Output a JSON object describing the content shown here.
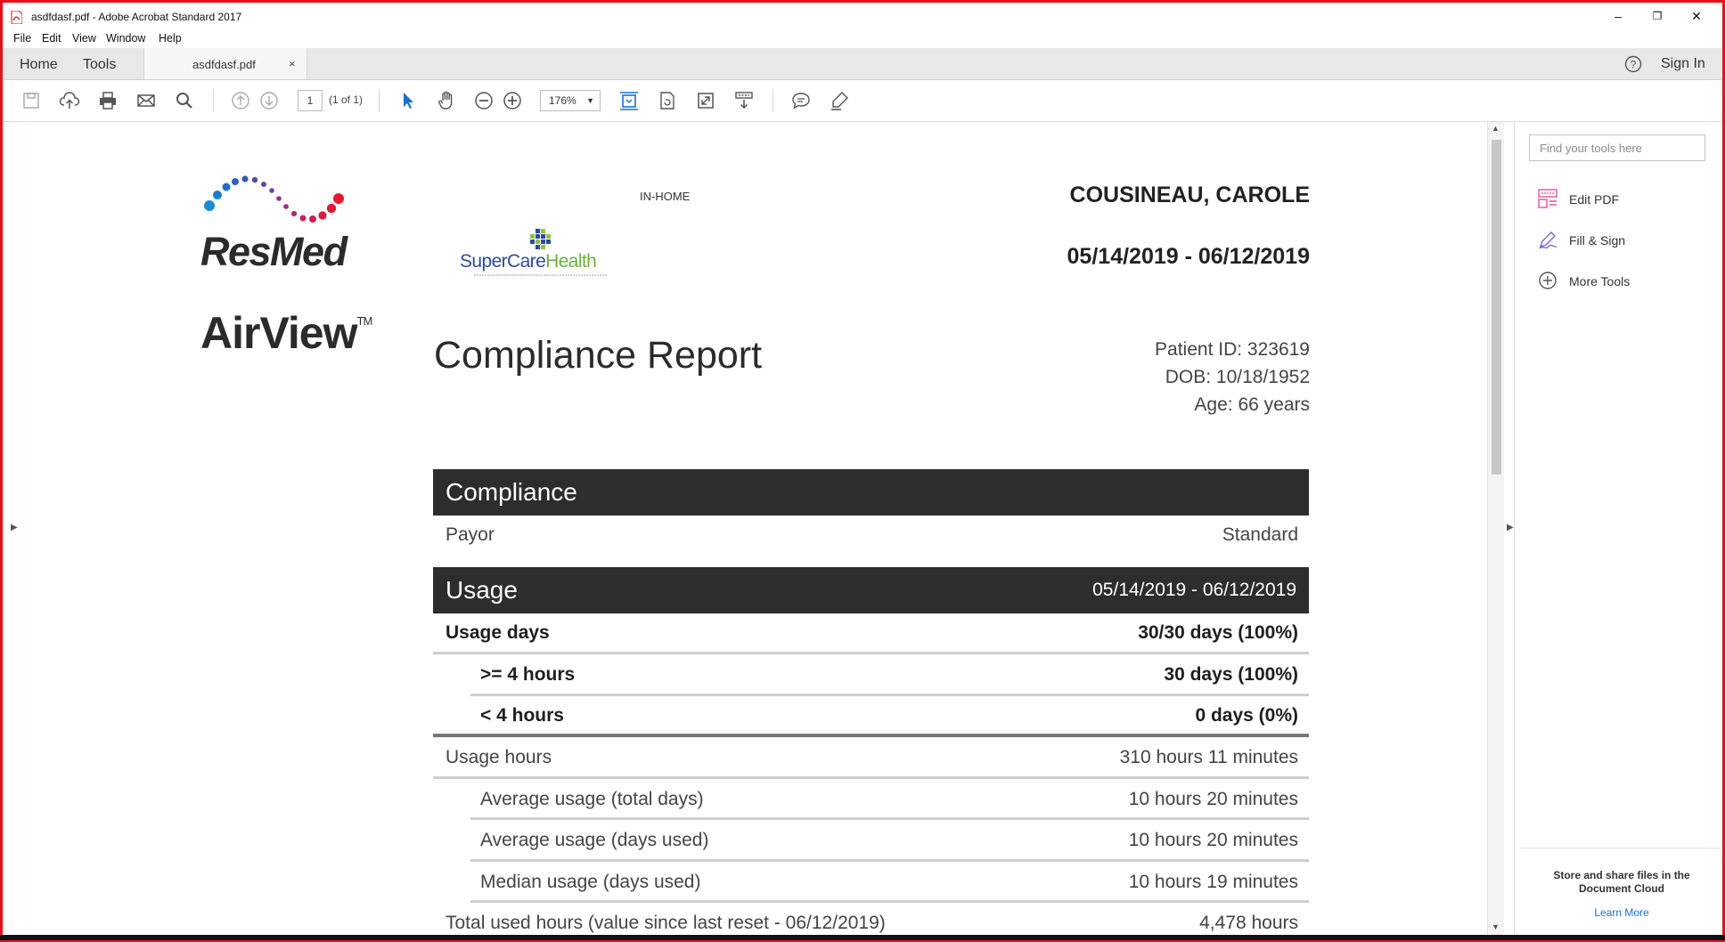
{
  "window": {
    "title": "asdfdasf.pdf - Adobe Acrobat Standard 2017",
    "minimize": "–",
    "restore": "❐",
    "close": "✕"
  },
  "menu": [
    "File",
    "Edit",
    "View",
    "Window",
    "Help"
  ],
  "tabs": {
    "home": "Home",
    "tools": "Tools",
    "document": "asdfdasf.pdf",
    "close": "×",
    "sign_in": "Sign In"
  },
  "toolbar": {
    "page_number": "1",
    "page_of": "(1 of 1)",
    "zoom": "176%",
    "icons": [
      "save-icon",
      "upload-icon",
      "print-icon",
      "email-icon",
      "search-icon",
      "prev-page-icon",
      "next-page-icon",
      "select-pointer-icon",
      "hand-icon",
      "zoom-out-icon",
      "zoom-in-icon",
      "fit-page-icon",
      "rotate-icon",
      "full-screen-icon",
      "scroll-mode-icon",
      "comment-icon",
      "highlight-icon"
    ]
  },
  "right_panel": {
    "search_placeholder": "Find your tools here",
    "tools": [
      {
        "label": "Edit PDF",
        "icon": "edit-pdf-icon",
        "color": "#e84fa0"
      },
      {
        "label": "Fill & Sign",
        "icon": "fill-sign-icon",
        "color": "#7a5fd8"
      },
      {
        "label": "More Tools",
        "icon": "more-tools-icon",
        "color": "#555555"
      }
    ],
    "footer_text": "Store and share files in the Document Cloud",
    "learn_more": "Learn More"
  },
  "report": {
    "brand": "ResMed",
    "product": "AirView",
    "product_tm": "TM",
    "provider_label": "IN-HOME",
    "provider_logo": "SuperCareHealth",
    "patient_name": "COUSINEAU, CAROLE",
    "date_range": "05/14/2019 - 06/12/2019",
    "patient_id": "Patient ID: 323619",
    "dob": "DOB: 10/18/1952",
    "age": "Age: 66 years",
    "title": "Compliance Report",
    "compliance": {
      "header": "Compliance",
      "payor_label": "Payor",
      "payor_value": "Standard"
    },
    "usage": {
      "header": "Usage",
      "header_range": "05/14/2019 - 06/12/2019",
      "rows": [
        {
          "label": "Usage days",
          "value": "30/30 days (100%)"
        },
        {
          "label": ">= 4 hours",
          "value": "30 days (100%)"
        },
        {
          "label": "< 4 hours",
          "value": "0 days (0%)"
        },
        {
          "label": "Usage hours",
          "value": "310 hours 11 minutes"
        },
        {
          "label": "Average usage (total days)",
          "value": "10 hours 20 minutes"
        },
        {
          "label": "Average usage (days used)",
          "value": "10 hours 20 minutes"
        },
        {
          "label": "Median usage (days used)",
          "value": "10 hours 19 minutes"
        },
        {
          "label": "Total used hours (value since last reset - 06/12/2019)",
          "value": "4,478 hours"
        }
      ]
    }
  },
  "colors": {
    "window_border": "#e1141b",
    "report_header_bg": "#2d2d2d",
    "accent_blue": "#1a6fd1"
  }
}
